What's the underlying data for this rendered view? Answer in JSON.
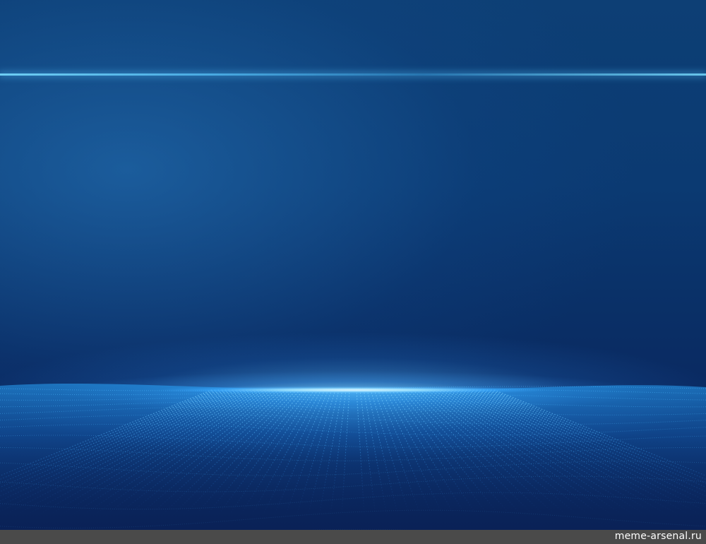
{
  "image": {
    "background_top_color": "#0d3f75",
    "background_bottom_color": "#0a2257",
    "glow_color": "#5ac8ff",
    "horizon_highlight_color": "#ffffff"
  },
  "watermark": {
    "text": "meme-arsenal.ru",
    "bar_color": "#4a4a4a"
  }
}
